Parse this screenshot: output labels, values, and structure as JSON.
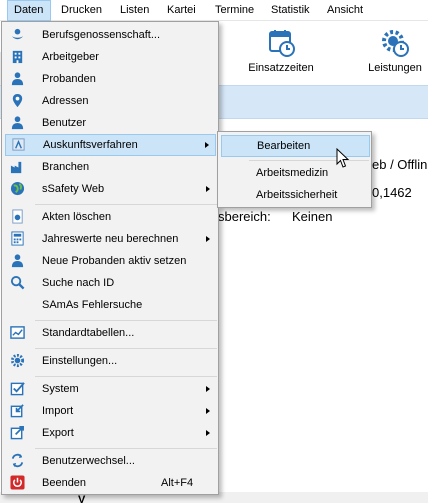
{
  "menubar": {
    "items": [
      {
        "label": "Daten"
      },
      {
        "label": "Drucken"
      },
      {
        "label": "Listen"
      },
      {
        "label": "Kartei"
      },
      {
        "label": "Termine"
      },
      {
        "label": "Statistik"
      },
      {
        "label": "Ansicht"
      }
    ]
  },
  "ribbon": {
    "einsatzzeiten_label": "Einsatzzeiten",
    "leistungen_label": "Leistungen"
  },
  "background": {
    "text_web": "eb / Offlin",
    "text_version": "0,1462",
    "text_bereich": "sbereich:",
    "text_keinen": "Keinen",
    "bottom_fragment": "V"
  },
  "menu": {
    "items": [
      {
        "label": "Berufsgenossenschaft...",
        "icon": "bg-icon"
      },
      {
        "label": "Arbeitgeber",
        "icon": "building-icon"
      },
      {
        "label": "Probanden",
        "icon": "person-icon"
      },
      {
        "label": "Adressen",
        "icon": "map-pin-icon"
      },
      {
        "label": "Benutzer",
        "icon": "user-icon"
      },
      {
        "label": "Auskunftsverfahren",
        "icon": "inquiry-icon"
      },
      {
        "label": "Branchen",
        "icon": "industry-icon"
      },
      {
        "label": "sSafety Web",
        "icon": "globe-icon"
      },
      {
        "label": "Akten löschen",
        "icon": "delete-file-icon"
      },
      {
        "label": "Jahreswerte neu berechnen",
        "icon": "calculator-icon"
      },
      {
        "label": "Neue Probanden aktiv setzen",
        "icon": "person-activate-icon"
      },
      {
        "label": "Suche nach ID",
        "icon": "search-icon"
      },
      {
        "label": "SAmAs Fehlersuche",
        "icon": ""
      },
      {
        "label": "Standardtabellen...",
        "icon": "table-icon"
      },
      {
        "label": "Einstellungen...",
        "icon": "gear-icon"
      },
      {
        "label": "System",
        "icon": "checkbox-icon"
      },
      {
        "label": "Import",
        "icon": "import-icon"
      },
      {
        "label": "Export",
        "icon": "export-icon"
      },
      {
        "label": "Benutzerwechsel...",
        "icon": "switch-user-icon"
      },
      {
        "label": "Beenden",
        "icon": "power-icon",
        "shortcut": "Alt+F4"
      }
    ]
  },
  "submenu": {
    "items": [
      {
        "label": "Bearbeiten"
      },
      {
        "label": "Arbeitsmedizin"
      },
      {
        "label": "Arbeitssicherheit"
      }
    ]
  },
  "colors": {
    "highlight": "#cce4f7",
    "highlight_border": "#99c9ef",
    "band": "#d6e7f7",
    "icon_blue": "#2a73b8",
    "power_red": "#d22a2a"
  }
}
